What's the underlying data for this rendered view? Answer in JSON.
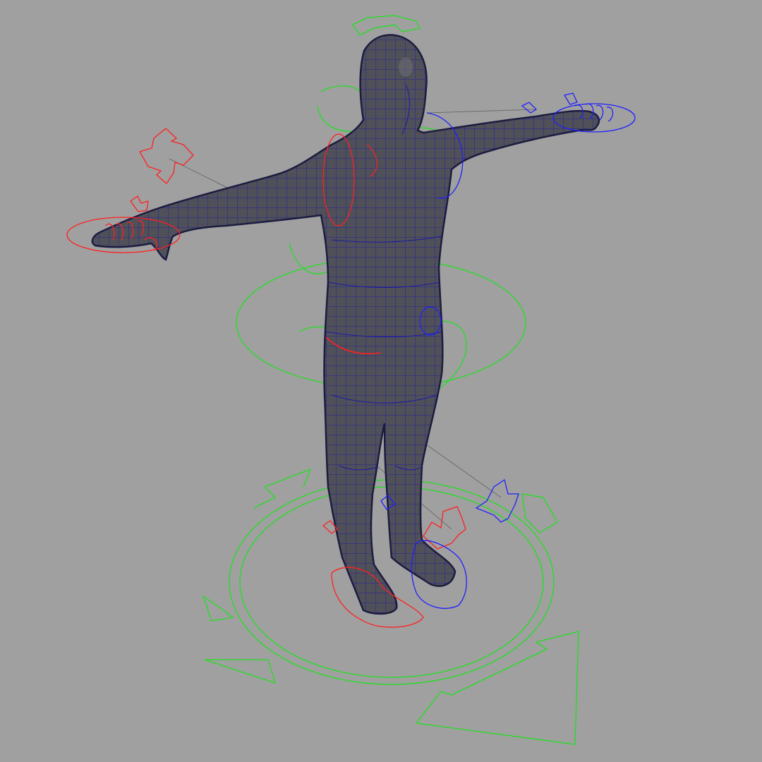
{
  "viewport": {
    "background": "#a0a0a0",
    "mesh_fill": "#505058",
    "mesh_wire": "#1a1aa8",
    "mesh_outline": "#1c1c40",
    "ctrl_left": "#ff2020",
    "ctrl_center": "#20e020",
    "ctrl_right": "#2020ff",
    "guide_line": "#6c6c6c"
  },
  "controls": [
    {
      "name": "head-control",
      "side": "center"
    },
    {
      "name": "chest-control",
      "side": "center"
    },
    {
      "name": "hips-control",
      "side": "center"
    },
    {
      "name": "root-control",
      "side": "center"
    },
    {
      "name": "left-arm-ik-control",
      "side": "left"
    },
    {
      "name": "left-hand-control",
      "side": "left"
    },
    {
      "name": "left-foot-control",
      "side": "left"
    },
    {
      "name": "right-arm-ik-control",
      "side": "right"
    },
    {
      "name": "right-hand-control",
      "side": "right"
    },
    {
      "name": "right-foot-control",
      "side": "right"
    }
  ]
}
